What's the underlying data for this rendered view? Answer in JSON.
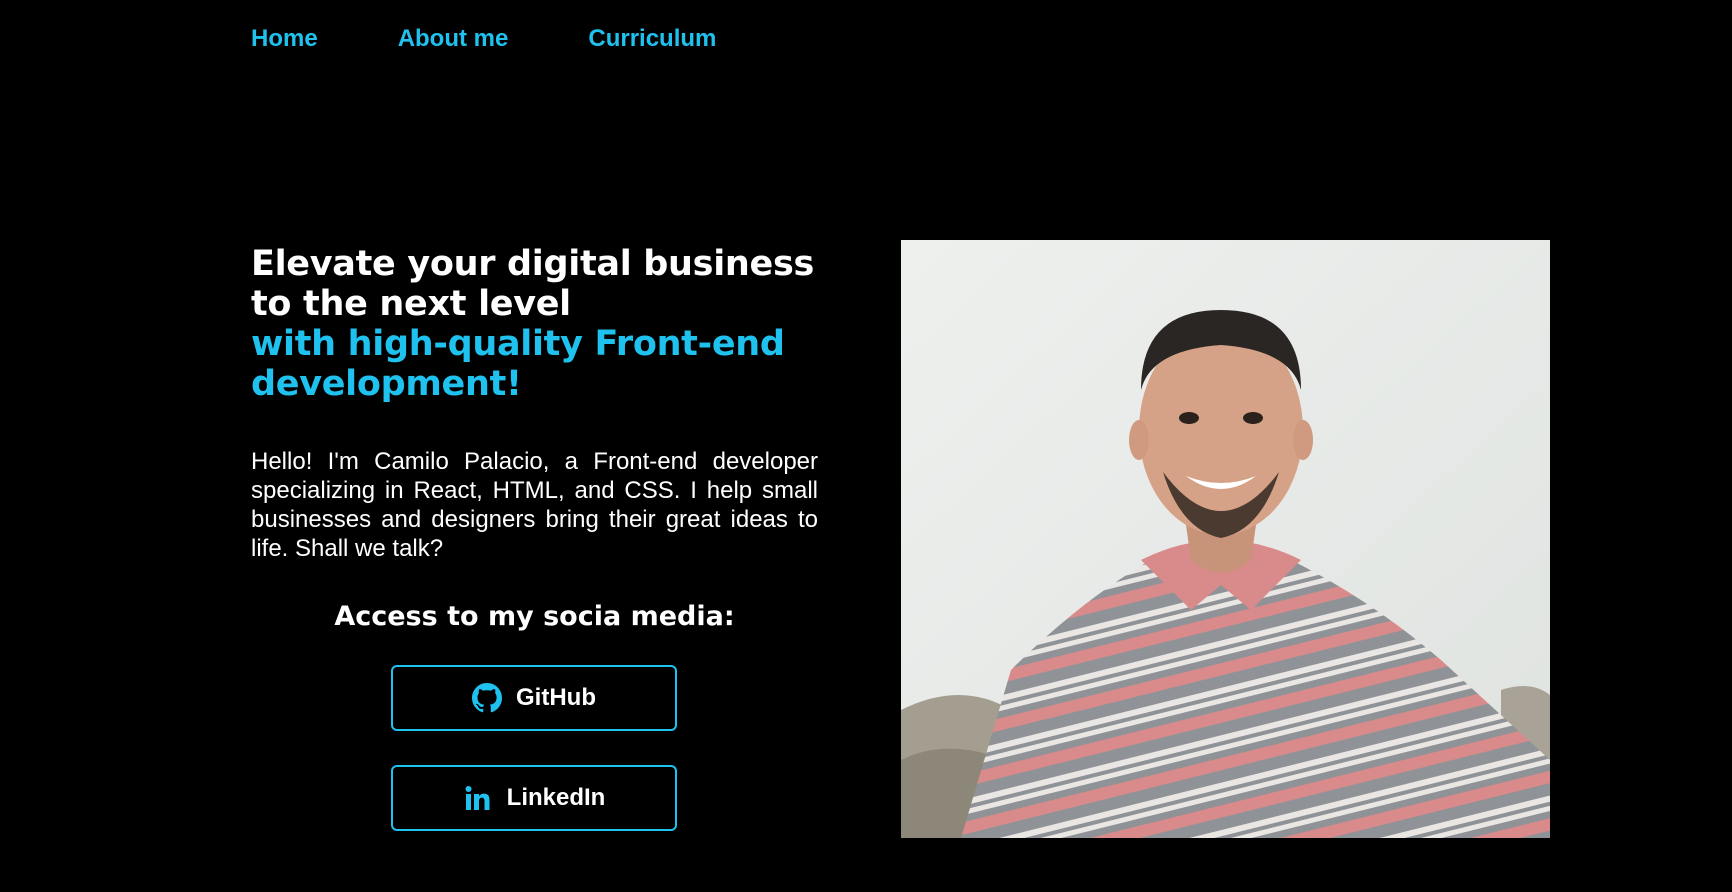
{
  "nav": {
    "items": [
      {
        "label": "Home"
      },
      {
        "label": "About me"
      },
      {
        "label": "Curriculum"
      }
    ]
  },
  "hero": {
    "headline_white": "Elevate your digital business to the next level",
    "headline_blue": "with high-quality Front-end development!",
    "intro": "Hello! I'm Camilo Palacio, a Front-end developer specializing in React, HTML, and CSS. I help small businesses and designers bring their great ideas to life. Shall we talk?"
  },
  "social": {
    "title": "Access to my socia media:",
    "buttons": [
      {
        "label": "GitHub",
        "icon": "github-icon"
      },
      {
        "label": "LinkedIn",
        "icon": "linkedin-icon"
      }
    ]
  },
  "colors": {
    "background": "#000000",
    "accent": "#1fc2ee",
    "text": "#ffffff"
  }
}
